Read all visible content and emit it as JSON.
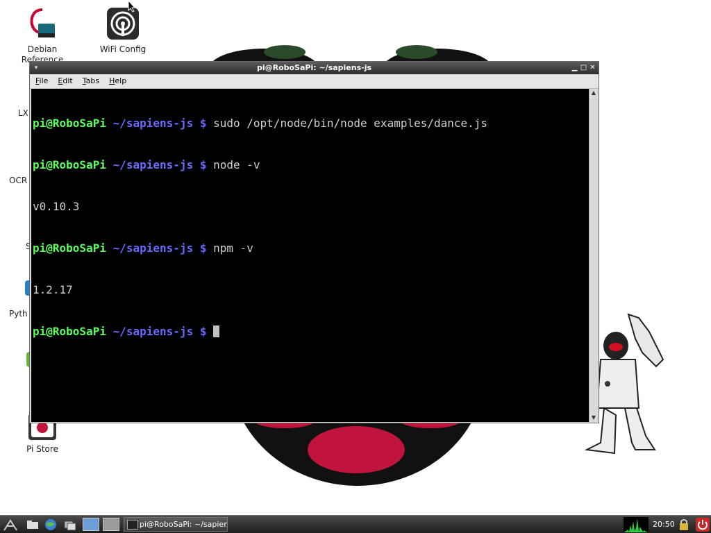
{
  "desktop": {
    "icons": [
      {
        "label_line1": "Debian",
        "label_line2": "Reference",
        "icon": "debian-reference-icon"
      },
      {
        "label_line1": "WiFi Config",
        "label_line2": "",
        "icon": "wifi-config-icon"
      },
      {
        "label_line1": "Pi Store",
        "label_line2": "",
        "icon": "pi-store-icon"
      }
    ],
    "partial_labels": [
      "LX",
      "OCR",
      "S",
      "Pyth"
    ]
  },
  "terminal": {
    "title": "pi@RoboSaPi: ~/sapiens-js",
    "menu": [
      {
        "underline": "F",
        "rest": "ile"
      },
      {
        "underline": "E",
        "rest": "dit"
      },
      {
        "underline": "T",
        "rest": "abs"
      },
      {
        "underline": "H",
        "rest": "elp"
      }
    ],
    "prompt_user": "pi@RoboSaPi",
    "prompt_path": "~/sapiens-js $",
    "lines": [
      {
        "type": "cmd",
        "text": "sudo /opt/node/bin/node examples/dance.js"
      },
      {
        "type": "cmd",
        "text": "node -v"
      },
      {
        "type": "out",
        "text": "v0.10.3"
      },
      {
        "type": "cmd",
        "text": "npm -v"
      },
      {
        "type": "out",
        "text": "1.2.17"
      },
      {
        "type": "cmd-cursor",
        "text": ""
      }
    ]
  },
  "taskbar": {
    "task_label": "pi@RoboSaPi: ~/sapien...",
    "clock": "20:50"
  },
  "colors": {
    "prompt_user": "#5bff5b",
    "prompt_path": "#6a6aff",
    "raspberry": "#c0143c"
  }
}
